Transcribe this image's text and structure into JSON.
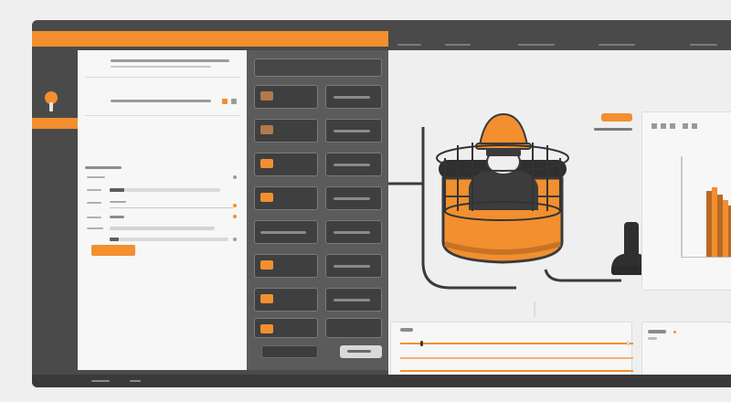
{
  "window": {
    "accent": "#f28f2f",
    "chrome": "#4a4a4a"
  },
  "header": {
    "app_title": "",
    "tabs": [
      {
        "label": ""
      },
      {
        "label": ""
      },
      {
        "label": ""
      },
      {
        "label": ""
      },
      {
        "label": ""
      }
    ]
  },
  "sidebar": {
    "items": [
      {
        "label": ""
      },
      {
        "label": ""
      },
      {
        "label": ""
      },
      {
        "label": ""
      }
    ]
  },
  "form": {
    "heading": "",
    "subheading": "",
    "fields": [
      {
        "label": ""
      },
      {
        "label": ""
      },
      {
        "label": ""
      },
      {
        "label": ""
      },
      {
        "label": ""
      }
    ],
    "apply_label": ""
  },
  "gallery": {
    "tiles": [],
    "buttons": [
      {
        "label": ""
      },
      {
        "label": ""
      }
    ]
  },
  "stage": {
    "caption": ""
  },
  "status": {
    "left": "",
    "right": ""
  }
}
